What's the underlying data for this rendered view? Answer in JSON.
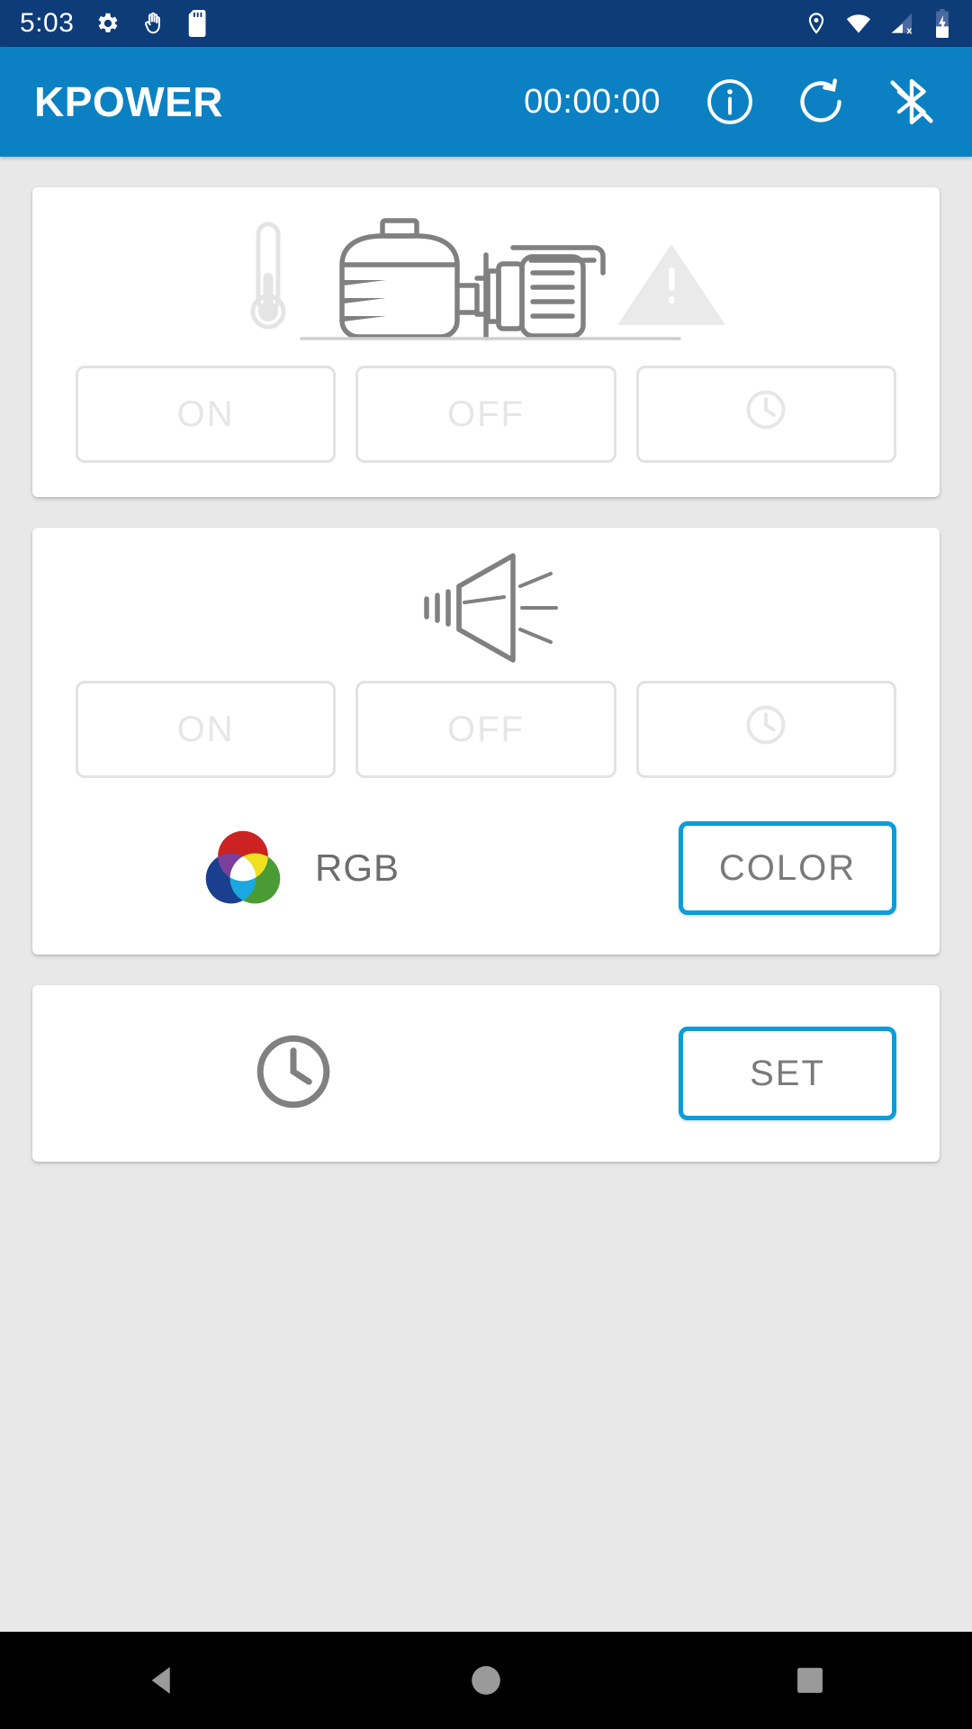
{
  "status_bar": {
    "time": "5:03",
    "left_icons": [
      "gear-icon",
      "hand-icon",
      "sd-card-icon"
    ],
    "right_icons": [
      "location-icon",
      "wifi-icon",
      "cellular-signal-off-icon",
      "battery-charging-icon"
    ],
    "background_color": "#0d3c79"
  },
  "app_bar": {
    "title": "KPOWER",
    "timer": "00:00:00",
    "info_label": "info-icon",
    "reset_label": "reset-icon",
    "bluetooth_label": "bluetooth-icon",
    "background_color": "#0b81c4"
  },
  "cards": {
    "pump": {
      "illustration": "pump-motor-thermometer-warning-illustration",
      "buttons": [
        {
          "label": "ON",
          "name": "pump-on-button",
          "enabled": false
        },
        {
          "label": "OFF",
          "name": "pump-off-button",
          "enabled": false
        },
        {
          "label": "",
          "name": "pump-timer-button",
          "icon": "clock-icon",
          "enabled": false
        }
      ]
    },
    "siren": {
      "illustration": "horn-speaker-illustration",
      "buttons": [
        {
          "label": "ON",
          "name": "siren-on-button",
          "enabled": false
        },
        {
          "label": "OFF",
          "name": "siren-off-button",
          "enabled": false
        },
        {
          "label": "",
          "name": "siren-timer-button",
          "icon": "clock-icon",
          "enabled": false
        }
      ],
      "rgb_label": "RGB",
      "color_button_label": "COLOR"
    },
    "timer": {
      "icon": "clock-icon",
      "set_button_label": "SET"
    }
  },
  "nav_bar": {
    "back": "back-triangle-icon",
    "home": "home-circle-icon",
    "recents": "recents-square-icon"
  },
  "colors": {
    "accent": "#0d9cd8",
    "app_bar": "#0b81c4",
    "status_bar": "#0d3c79",
    "page_bg": "#e8e8e8",
    "card_bg": "#ffffff",
    "disabled_text": "#e6e6e6",
    "icon_gray": "#808080",
    "rgb_red": "#cc2222",
    "rgb_green": "#4a9b33",
    "rgb_blue": "#1b3f8f"
  }
}
